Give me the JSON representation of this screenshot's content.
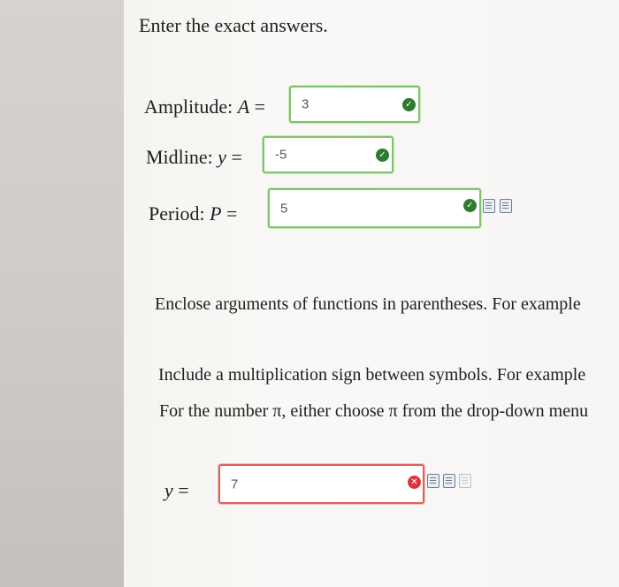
{
  "instructions": "Enter the exact answers.",
  "amplitude": {
    "label_prefix": "Amplitude: ",
    "var": "A",
    "eq": " =",
    "value": "3",
    "status": "correct"
  },
  "midline": {
    "label_prefix": "Midline: ",
    "var": "y",
    "eq": " =",
    "value": "-5",
    "status": "correct"
  },
  "period": {
    "label_prefix": "Period: ",
    "var": "P",
    "eq": " =",
    "value": "5",
    "status": "correct"
  },
  "note_functions": "Enclose arguments of functions in parentheses. For example",
  "note_multiplication": "Include a multiplication sign between symbols. For example",
  "note_pi": "For the number π, either choose π from the drop-down menu",
  "equation": {
    "var": "y",
    "eq": " =",
    "value": "7",
    "status": "incorrect"
  },
  "icons": {
    "correct": "check-circle-icon",
    "incorrect": "x-circle-icon",
    "tool_1": "formula-editor-icon",
    "tool_2": "sigma-palette-icon",
    "tool_3": "blank-page-icon"
  },
  "colors": {
    "correct": "#2e7a2e",
    "correct_border": "#7fc46a",
    "incorrect": "#d9383a",
    "incorrect_border": "#e0605c"
  }
}
